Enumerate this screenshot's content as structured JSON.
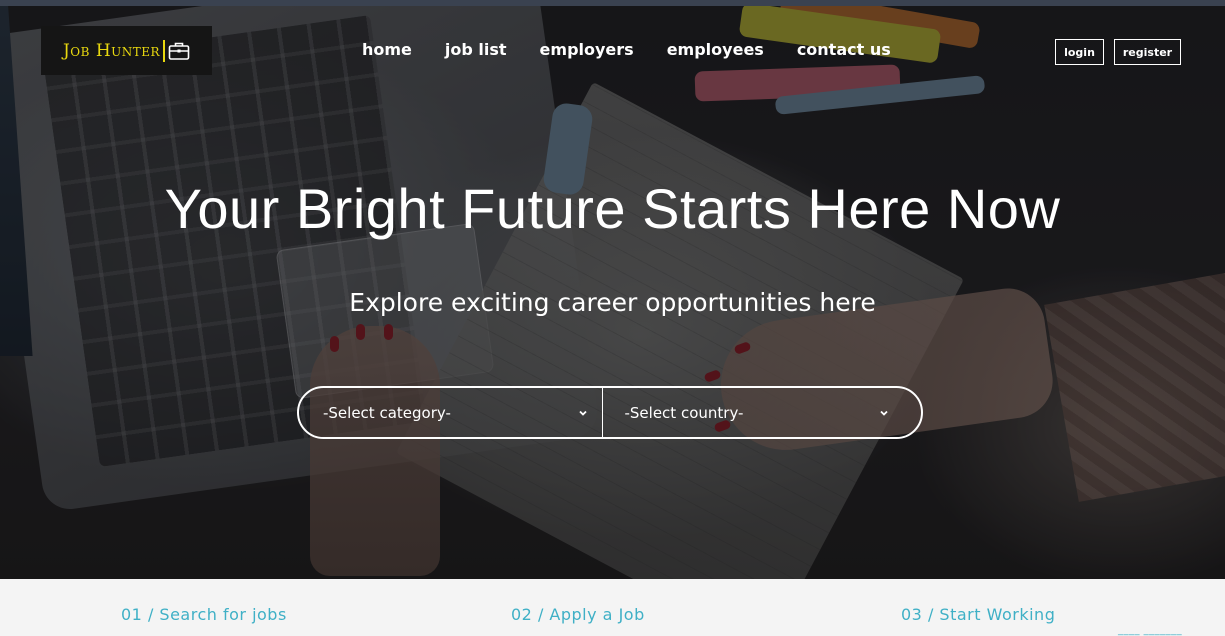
{
  "brand": {
    "logo_text": "Job Hunter",
    "logo_color": "#e9d90f",
    "logo_icon": "briefcase-icon"
  },
  "nav": {
    "items": [
      {
        "label": "home"
      },
      {
        "label": "job list"
      },
      {
        "label": "employers"
      },
      {
        "label": "employees"
      },
      {
        "label": "contact us"
      }
    ]
  },
  "auth": {
    "login_label": "login",
    "register_label": "register"
  },
  "hero": {
    "headline": "Your Bright Future Starts Here Now",
    "subline": "Explore exciting career opportunities here",
    "category_select": {
      "selected": "-Select category-",
      "icon": "chevron-down-icon"
    },
    "country_select": {
      "selected": "-Select country-",
      "icon": "chevron-down-icon"
    }
  },
  "steps": [
    {
      "label": "01 / Search for jobs"
    },
    {
      "label": "02 / Apply a Job"
    },
    {
      "label": "03 / Start Working"
    },
    {
      "label": "____ _______"
    }
  ],
  "colors": {
    "accent": "#3fb0c6",
    "topbar": "#3a4250",
    "steps_bg": "#f4f4f4"
  }
}
